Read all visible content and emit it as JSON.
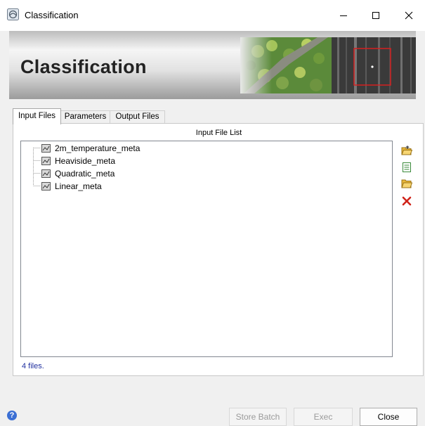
{
  "window": {
    "title": "Classification"
  },
  "banner": {
    "title": "Classification"
  },
  "tabs": [
    {
      "label": "Input Files",
      "active": true
    },
    {
      "label": "Parameters",
      "active": false
    },
    {
      "label": "Output Files",
      "active": false
    }
  ],
  "input_list": {
    "header": "Input File List",
    "items": [
      "2m_temperature_meta",
      "Heaviside_meta",
      "Quadratic_meta",
      "Linear_meta"
    ],
    "status": "4 files."
  },
  "side_actions": [
    {
      "icon": "open-folder-icon"
    },
    {
      "icon": "document-icon"
    },
    {
      "icon": "folder-icon"
    },
    {
      "icon": "delete-icon"
    }
  ],
  "footer": {
    "store_batch": "Store Batch",
    "exec": "Exec",
    "close": "Close"
  },
  "colors": {
    "status_text": "#1f2f9f",
    "delete_red": "#d0231a",
    "folder_yellow": "#f0c040"
  }
}
